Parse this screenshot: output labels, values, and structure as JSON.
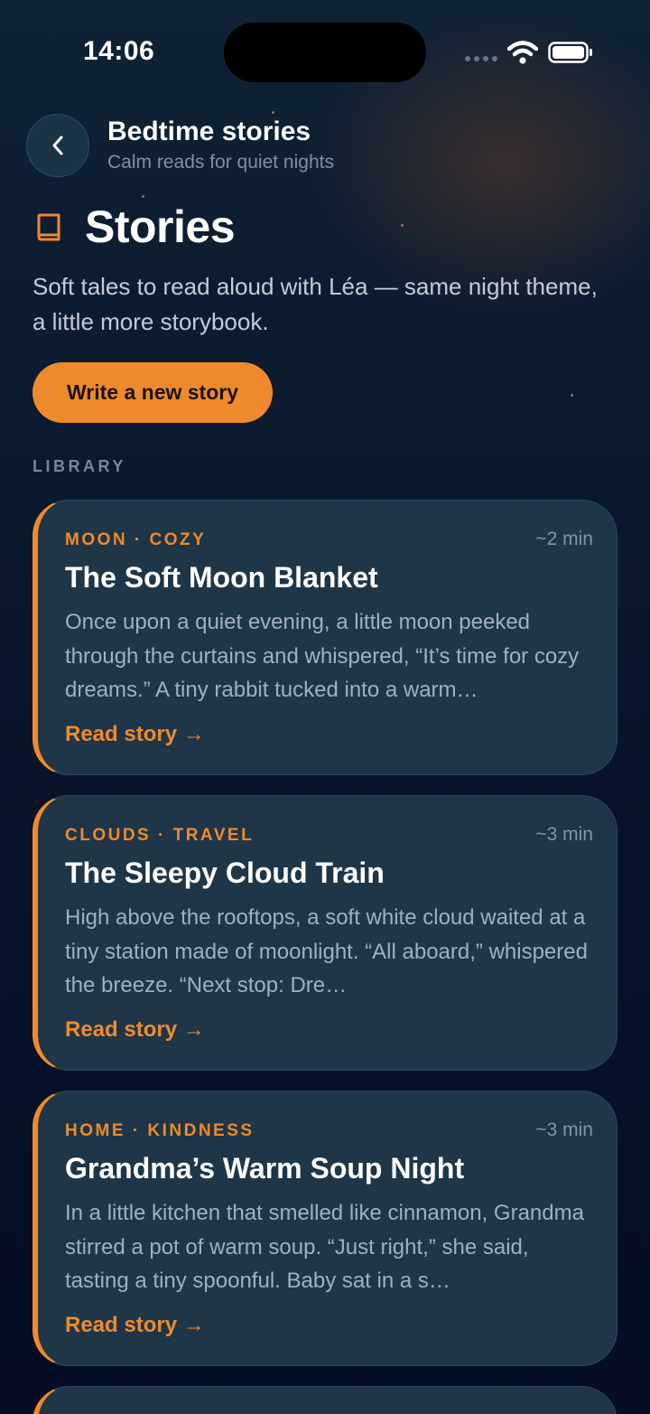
{
  "status_bar": {
    "time": "14:06"
  },
  "header": {
    "title": "Bedtime stories",
    "subtitle": "Calm reads for quiet nights"
  },
  "page": {
    "title": "Stories",
    "intro": "Soft tales to read aloud with Léa — same night theme, a little more storybook.",
    "cta_label": "Write a new story",
    "section_label": "LIBRARY"
  },
  "stories": [
    {
      "tags": "MOON · COZY",
      "duration": "~2 min",
      "title": "The Soft Moon Blanket",
      "excerpt": "Once upon a quiet evening, a little moon peeked through the curtains and whispered, “It’s time for cozy dreams.” A tiny rabbit tucked into a warm…",
      "read_label": "Read story →"
    },
    {
      "tags": "CLOUDS · TRAVEL",
      "duration": "~3 min",
      "title": "The Sleepy Cloud Train",
      "excerpt": "High above the rooftops, a soft white cloud waited at a tiny station made of moonlight. “All aboard,” whispered the breeze. “Next stop: Dre…",
      "read_label": "Read story →"
    },
    {
      "tags": "HOME · KINDNESS",
      "duration": "~3 min",
      "title": "Grandma’s Warm Soup Night",
      "excerpt": "In a little kitchen that smelled like cinnamon, Grandma stirred a pot of warm soup. “Just right,” she said, tasting a tiny spoonful. Baby sat in a s…",
      "read_label": "Read story →"
    }
  ],
  "colors": {
    "accent": "#ef8a2c",
    "background": "#0b1a2e",
    "card": "#1e3648"
  },
  "icons": {
    "back": "chevron-left-icon",
    "title": "book-icon",
    "wifi": "wifi-icon",
    "battery": "battery-icon"
  }
}
